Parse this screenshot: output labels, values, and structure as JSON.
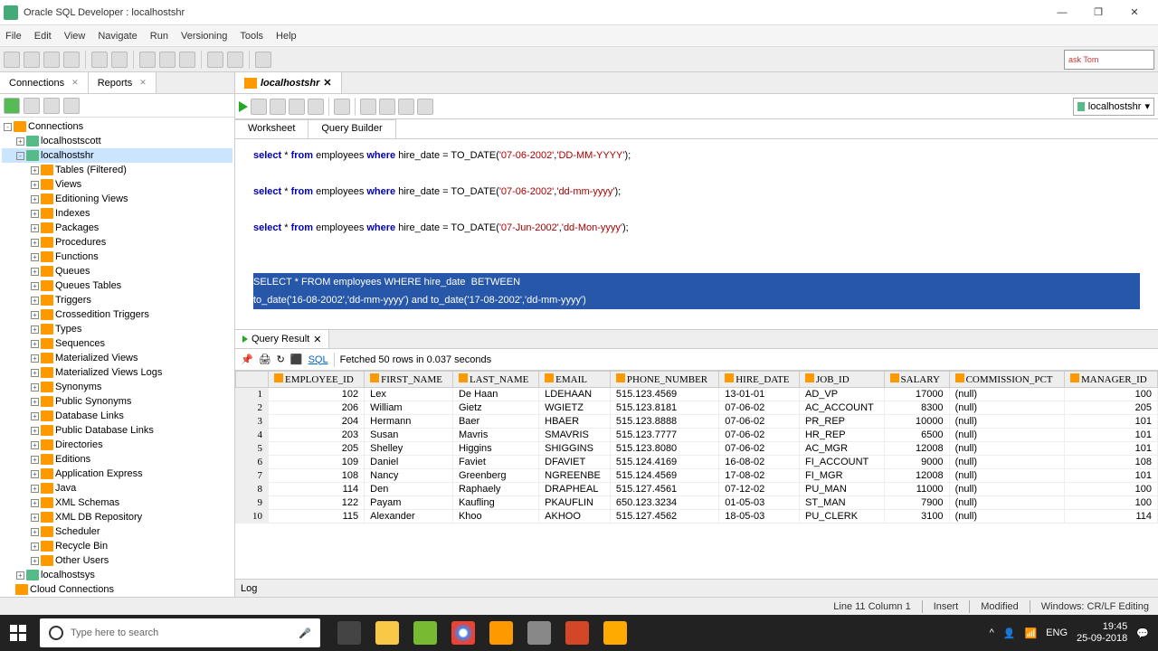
{
  "window": {
    "title": "Oracle SQL Developer : localhostshr"
  },
  "menu": [
    "File",
    "Edit",
    "View",
    "Navigate",
    "Run",
    "Versioning",
    "Tools",
    "Help"
  ],
  "ask": "ask\nTom",
  "sidebar": {
    "tabs": [
      {
        "label": "Connections"
      },
      {
        "label": "Reports"
      }
    ],
    "root": "Connections",
    "conns": [
      "localhostscott",
      "localhostshr"
    ],
    "items": [
      "Tables (Filtered)",
      "Views",
      "Editioning Views",
      "Indexes",
      "Packages",
      "Procedures",
      "Functions",
      "Queues",
      "Queues Tables",
      "Triggers",
      "Crossedition Triggers",
      "Types",
      "Sequences",
      "Materialized Views",
      "Materialized Views Logs",
      "Synonyms",
      "Public Synonyms",
      "Database Links",
      "Public Database Links",
      "Directories",
      "Editions",
      "Application Express",
      "Java",
      "XML Schemas",
      "XML DB Repository",
      "Scheduler",
      "Recycle Bin",
      "Other Users"
    ],
    "conn3": "localhostsys",
    "cloud": "Cloud Connections"
  },
  "editor": {
    "tab": "localhostshr",
    "ws_tabs": [
      "Worksheet",
      "Query Builder"
    ],
    "conn": "localhostshr",
    "sql": {
      "l1": {
        "pre": "select",
        "star": " * ",
        "from": "from",
        "emp": " employees ",
        "where": "where",
        "hd": " hire_date = TO_DATE(",
        "s1": "'07-06-2002'",
        "c": ",",
        "s2": "'DD-MM-YYYY'",
        "end": ");"
      },
      "l2": {
        "s2": "'dd-mm-yyyy'"
      },
      "l3": {
        "s1": "'07-Jun-2002'",
        "s2": "'dd-Mon-yyyy'"
      },
      "l4a": "SELECT * FROM employees WHERE hire_date  BETWEEN",
      "l4b": "to_date('16-08-2002','dd-mm-yyyy') and to_date('17-08-2002','dd-mm-yyyy')"
    }
  },
  "result": {
    "tab": "Query Result",
    "status": "Fetched 50 rows in 0.037 seconds",
    "sql_label": "SQL",
    "cols": [
      "EMPLOYEE_ID",
      "FIRST_NAME",
      "LAST_NAME",
      "EMAIL",
      "PHONE_NUMBER",
      "HIRE_DATE",
      "JOB_ID",
      "SALARY",
      "COMMISSION_PCT",
      "MANAGER_ID"
    ],
    "rows": [
      [
        102,
        "Lex",
        "De Haan",
        "LDEHAAN",
        "515.123.4569",
        "13-01-01",
        "AD_VP",
        17000,
        "(null)",
        100
      ],
      [
        206,
        "William",
        "Gietz",
        "WGIETZ",
        "515.123.8181",
        "07-06-02",
        "AC_ACCOUNT",
        8300,
        "(null)",
        205
      ],
      [
        204,
        "Hermann",
        "Baer",
        "HBAER",
        "515.123.8888",
        "07-06-02",
        "PR_REP",
        10000,
        "(null)",
        101
      ],
      [
        203,
        "Susan",
        "Mavris",
        "SMAVRIS",
        "515.123.7777",
        "07-06-02",
        "HR_REP",
        6500,
        "(null)",
        101
      ],
      [
        205,
        "Shelley",
        "Higgins",
        "SHIGGINS",
        "515.123.8080",
        "07-06-02",
        "AC_MGR",
        12008,
        "(null)",
        101
      ],
      [
        109,
        "Daniel",
        "Faviet",
        "DFAVIET",
        "515.124.4169",
        "16-08-02",
        "FI_ACCOUNT",
        9000,
        "(null)",
        108
      ],
      [
        108,
        "Nancy",
        "Greenberg",
        "NGREENBE",
        "515.124.4569",
        "17-08-02",
        "FI_MGR",
        12008,
        "(null)",
        101
      ],
      [
        114,
        "Den",
        "Raphaely",
        "DRAPHEAL",
        "515.127.4561",
        "07-12-02",
        "PU_MAN",
        11000,
        "(null)",
        100
      ],
      [
        122,
        "Payam",
        "Kaufling",
        "PKAUFLIN",
        "650.123.3234",
        "01-05-03",
        "ST_MAN",
        7900,
        "(null)",
        100
      ],
      [
        115,
        "Alexander",
        "Khoo",
        "AKHOO",
        "515.127.4562",
        "18-05-03",
        "PU_CLERK",
        3100,
        "(null)",
        114
      ]
    ]
  },
  "log": "Log",
  "status": {
    "pos": "Line 11 Column 1",
    "ins": "Insert",
    "mod": "Modified",
    "enc": "Windows: CR/LF Editing"
  },
  "taskbar": {
    "search": "Type here to search",
    "lang": "ENG",
    "time": "19:45",
    "date": "25-09-2018"
  }
}
